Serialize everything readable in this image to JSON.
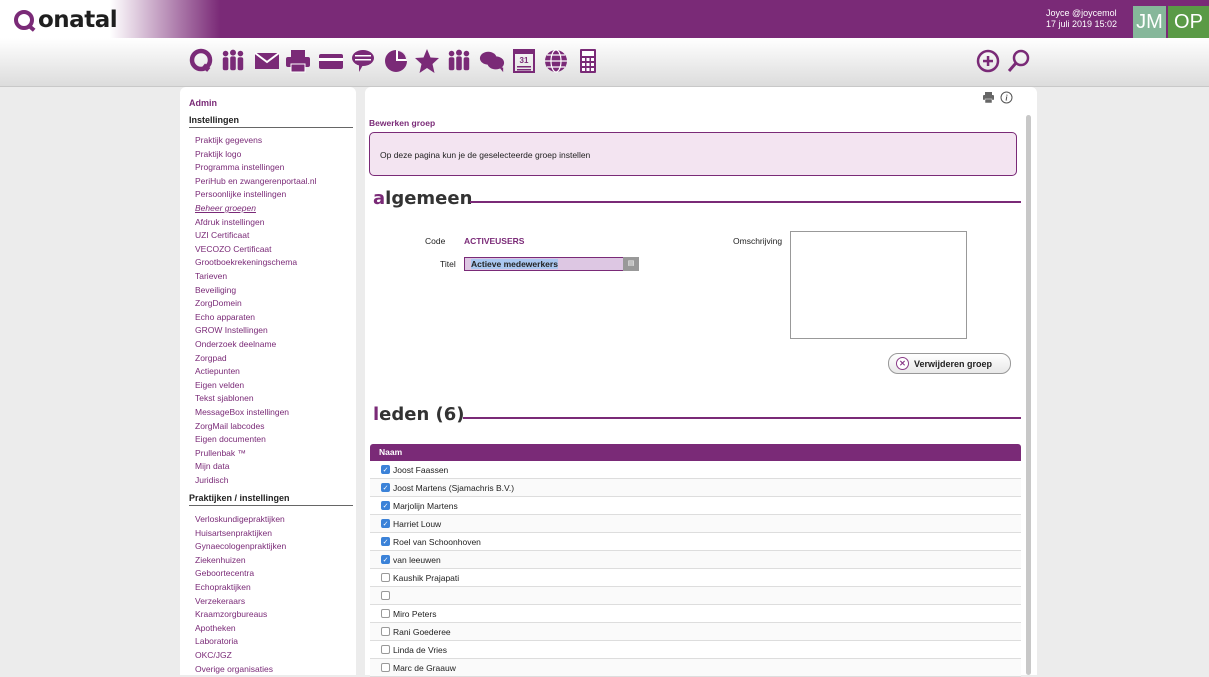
{
  "app": {
    "logo_text": "onatal"
  },
  "user": {
    "name": "Joyce @joycemol",
    "datetime": "17 juli 2019 15:02",
    "initials_1": "JM",
    "initials_2": "OP"
  },
  "toolbar_icons": [
    "home-icon",
    "people-icon",
    "mail-icon",
    "print-icon",
    "card-icon",
    "chat-icon",
    "chart-icon",
    "star-icon",
    "group-icon",
    "messages-icon",
    "calendar-icon",
    "globe-icon",
    "calculator-icon",
    "add-icon",
    "search-icon"
  ],
  "sidebar": {
    "title": "Admin",
    "section1": "Instellingen",
    "items1": [
      "Praktijk gegevens",
      "Praktijk logo",
      "Programma instellingen",
      "PeriHub en zwangerenportaal.nl",
      "Persoonlijke instellingen",
      "Beheer groepen",
      "Afdruk instellingen",
      "UZI Certificaat",
      "VECOZO Certificaat",
      "Grootboekrekeningschema",
      "Tarieven",
      "Beveiliging",
      "ZorgDomein",
      "Echo apparaten",
      "GROW Instellingen",
      "Onderzoek deelname",
      "Zorgpad",
      "Actiepunten",
      "Eigen velden",
      "Tekst sjablonen",
      "MessageBox instellingen",
      "ZorgMail labcodes",
      "Eigen documenten",
      "Prullenbak ™",
      "Mijn data",
      "Juridisch"
    ],
    "section2": "Praktijken / instellingen",
    "items2": [
      "Verloskundigepraktijken",
      "Huisartsenpraktijken",
      "Gynaecologenpraktijken",
      "Ziekenhuizen",
      "Geboortecentra",
      "Echopraktijken",
      "Verzekeraars",
      "Kraamzorgbureaus",
      "Apotheken",
      "Laboratoria",
      "OKC/JGZ",
      "Overige organisaties"
    ]
  },
  "main": {
    "page_title": "Bewerken groep",
    "info_text": "Op deze pagina kun je de geselecteerde groep instellen",
    "section_general": "algemeen",
    "code_label": "Code",
    "code_value": "ACTIVEUSERS",
    "titel_label": "Titel",
    "titel_value": "Actieve medewerkers",
    "omschrijving_label": "Omschrijving",
    "omschrijving_value": "",
    "delete_button": "Verwijderen groep",
    "section_members": "leden (6)",
    "table_header": "Naam",
    "members": [
      {
        "name": "Joost Faassen",
        "checked": true
      },
      {
        "name": "Joost Martens (Sjamachris B.V.)",
        "checked": true
      },
      {
        "name": "Marjolijn Martens",
        "checked": true
      },
      {
        "name": "Harriet Louw",
        "checked": true
      },
      {
        "name": "Roel van Schoonhoven",
        "checked": true
      },
      {
        "name": "van leeuwen",
        "checked": true
      },
      {
        "name": "Kaushik Prajapati",
        "checked": false
      },
      {
        "name": "",
        "checked": false
      },
      {
        "name": "Miro Peters",
        "checked": false
      },
      {
        "name": "Rani Goederee",
        "checked": false
      },
      {
        "name": "Linda de Vries",
        "checked": false
      },
      {
        "name": "Marc de Graauw",
        "checked": false
      }
    ]
  },
  "colors": {
    "brand": "#7a2a77",
    "check": "#3b82d8"
  }
}
